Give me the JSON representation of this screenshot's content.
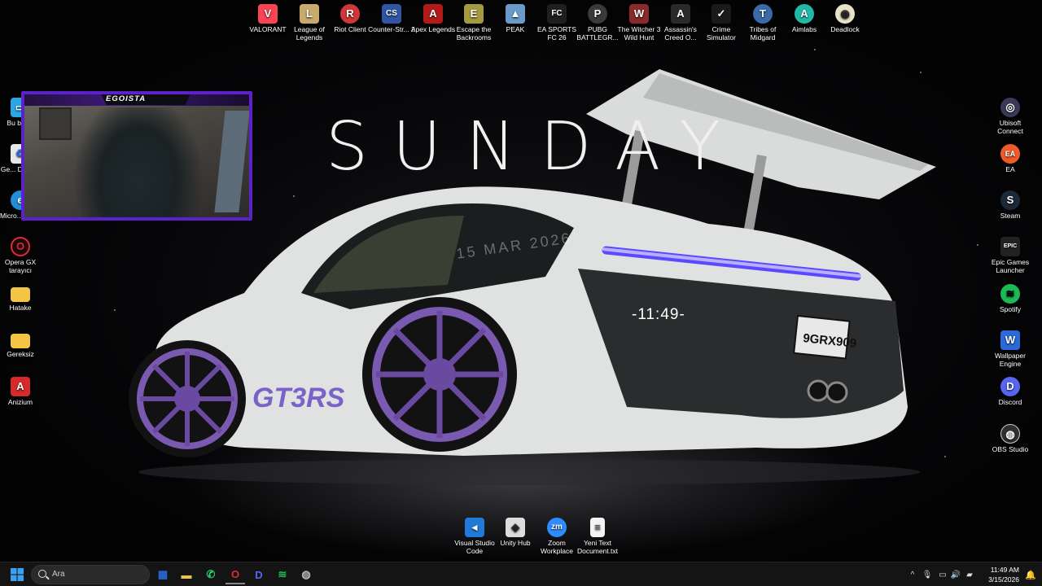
{
  "wallpaper": {
    "title": "SUNDAY",
    "date": "15 MAR 2026",
    "clock": "-11:49-",
    "plate": "9GRX909",
    "badge": "GT3RS"
  },
  "webcam": {
    "name": "EGOISTA"
  },
  "top_icons": [
    {
      "label": "VALORANT",
      "icon": "valorant-icon",
      "color": "#fa4454",
      "glyph": "V"
    },
    {
      "label": "League of Legends",
      "icon": "league-of-legends-icon",
      "color": "#c8aa6e",
      "glyph": "L"
    },
    {
      "label": "Riot Client",
      "icon": "riot-client-icon",
      "color": "#d13639",
      "glyph": "R"
    },
    {
      "label": "Counter-Str... 2",
      "icon": "counter-strike-icon",
      "color": "#2f55a4",
      "glyph": "CS"
    },
    {
      "label": "Apex Legends",
      "icon": "apex-legends-icon",
      "color": "#b31b1b",
      "glyph": "A"
    },
    {
      "label": "Escape the Backrooms",
      "icon": "escape-backrooms-icon",
      "color": "#a59a3d",
      "glyph": "E"
    },
    {
      "label": "PEAK",
      "icon": "peak-icon",
      "color": "#6a9ac8",
      "glyph": "▲"
    },
    {
      "label": "EA SPORTS FC 26",
      "icon": "ea-fc-icon",
      "color": "#1f1f1f",
      "glyph": "FC"
    },
    {
      "label": "PUBG BATTLEGR...",
      "icon": "pubg-icon",
      "color": "#3a3a3a",
      "glyph": "P"
    },
    {
      "label": "The Witcher 3 Wild Hunt",
      "icon": "witcher-icon",
      "color": "#8a2a2a",
      "glyph": "W"
    },
    {
      "label": "Assassin's Creed O...",
      "icon": "assassins-creed-icon",
      "color": "#2a2a2a",
      "glyph": "A"
    },
    {
      "label": "Crime Simulator",
      "icon": "crime-simulator-icon",
      "color": "#1a1a1a",
      "glyph": "✓"
    },
    {
      "label": "Tribes of Midgard",
      "icon": "tribes-of-midgard-icon",
      "color": "#3a6aa8",
      "glyph": "T"
    },
    {
      "label": "Aimlabs",
      "icon": "aimlabs-icon",
      "color": "#22b8a8",
      "glyph": "A"
    },
    {
      "label": "Deadlock",
      "icon": "deadlock-icon",
      "color": "#e8e2c8",
      "glyph": "◉"
    }
  ],
  "left_icons": [
    {
      "label": "Bu bilg...",
      "icon": "this-pc-icon",
      "color": "#2aa6e6",
      "glyph": "▭"
    },
    {
      "label": "Ge... Dönü...",
      "icon": "recycle-bin-icon",
      "color": "#e8e8e8",
      "glyph": "♻"
    },
    {
      "label": "Micro... Edge",
      "icon": "edge-icon",
      "color": "#1e8fd8",
      "glyph": "e"
    },
    {
      "label": "Opera GX tarayıcı",
      "icon": "opera-gx-icon",
      "color": "#1a0a0a",
      "glyph": "O"
    },
    {
      "label": "Hatake",
      "icon": "folder-icon",
      "color": "#f4c542",
      "glyph": ""
    },
    {
      "label": "Gereksiz",
      "icon": "folder-icon",
      "color": "#f4c542",
      "glyph": ""
    },
    {
      "label": "Anizium",
      "icon": "anizium-icon",
      "color": "#d42a2a",
      "glyph": "A"
    }
  ],
  "right_icons": [
    {
      "label": "Ubisoft Connect",
      "icon": "ubisoft-connect-icon",
      "color": "#3a3a58",
      "glyph": "◎"
    },
    {
      "label": "EA",
      "icon": "ea-icon",
      "color": "#f05a28",
      "glyph": "EA"
    },
    {
      "label": "Steam",
      "icon": "steam-icon",
      "color": "#1b2838",
      "glyph": "S"
    },
    {
      "label": "Epic Games Launcher",
      "icon": "epic-games-icon",
      "color": "#222222",
      "glyph": "EPIC"
    },
    {
      "label": "Spotify",
      "icon": "spotify-icon",
      "color": "#1db954",
      "glyph": "≋"
    },
    {
      "label": "Wallpaper Engine",
      "icon": "wallpaper-engine-icon",
      "color": "#2a6ad8",
      "glyph": "W"
    },
    {
      "label": "Discord",
      "icon": "discord-icon",
      "color": "#5865f2",
      "glyph": "D"
    },
    {
      "label": "OBS Studio",
      "icon": "obs-studio-icon",
      "color": "#303030",
      "glyph": "◍"
    }
  ],
  "bottom_icons": [
    {
      "label": "Visual Studio Code",
      "icon": "vscode-icon",
      "color": "#1f7ad8",
      "glyph": "◂"
    },
    {
      "label": "Unity Hub",
      "icon": "unity-hub-icon",
      "color": "#dcdcdc",
      "glyph": "◈"
    },
    {
      "label": "Zoom Workplace",
      "icon": "zoom-icon",
      "color": "#2d8cff",
      "glyph": "zm"
    },
    {
      "label": "Yeni Text Document.txt",
      "icon": "text-file-icon",
      "color": "#f4f4f4",
      "glyph": "≡"
    }
  ],
  "taskbar": {
    "search_placeholder": "Ara",
    "time": "11:49 AM",
    "date": "3/15/2026",
    "apps": [
      {
        "name": "widgets",
        "icon": "widgets-icon",
        "color": "#2a6ad8",
        "glyph": "▦"
      },
      {
        "name": "file-explorer",
        "icon": "file-explorer-icon",
        "color": "#f4c542",
        "glyph": "▬"
      },
      {
        "name": "whatsapp",
        "icon": "whatsapp-icon",
        "color": "#25d366",
        "glyph": "✆"
      },
      {
        "name": "opera-gx",
        "icon": "opera-gx-icon",
        "color": "#e0283c",
        "glyph": "O"
      },
      {
        "name": "discord",
        "icon": "discord-icon",
        "color": "#5865f2",
        "glyph": "D"
      },
      {
        "name": "spotify",
        "icon": "spotify-icon",
        "color": "#1db954",
        "glyph": "≋"
      },
      {
        "name": "obs-studio",
        "icon": "obs-studio-icon",
        "color": "#444444",
        "glyph": "◍"
      }
    ]
  }
}
